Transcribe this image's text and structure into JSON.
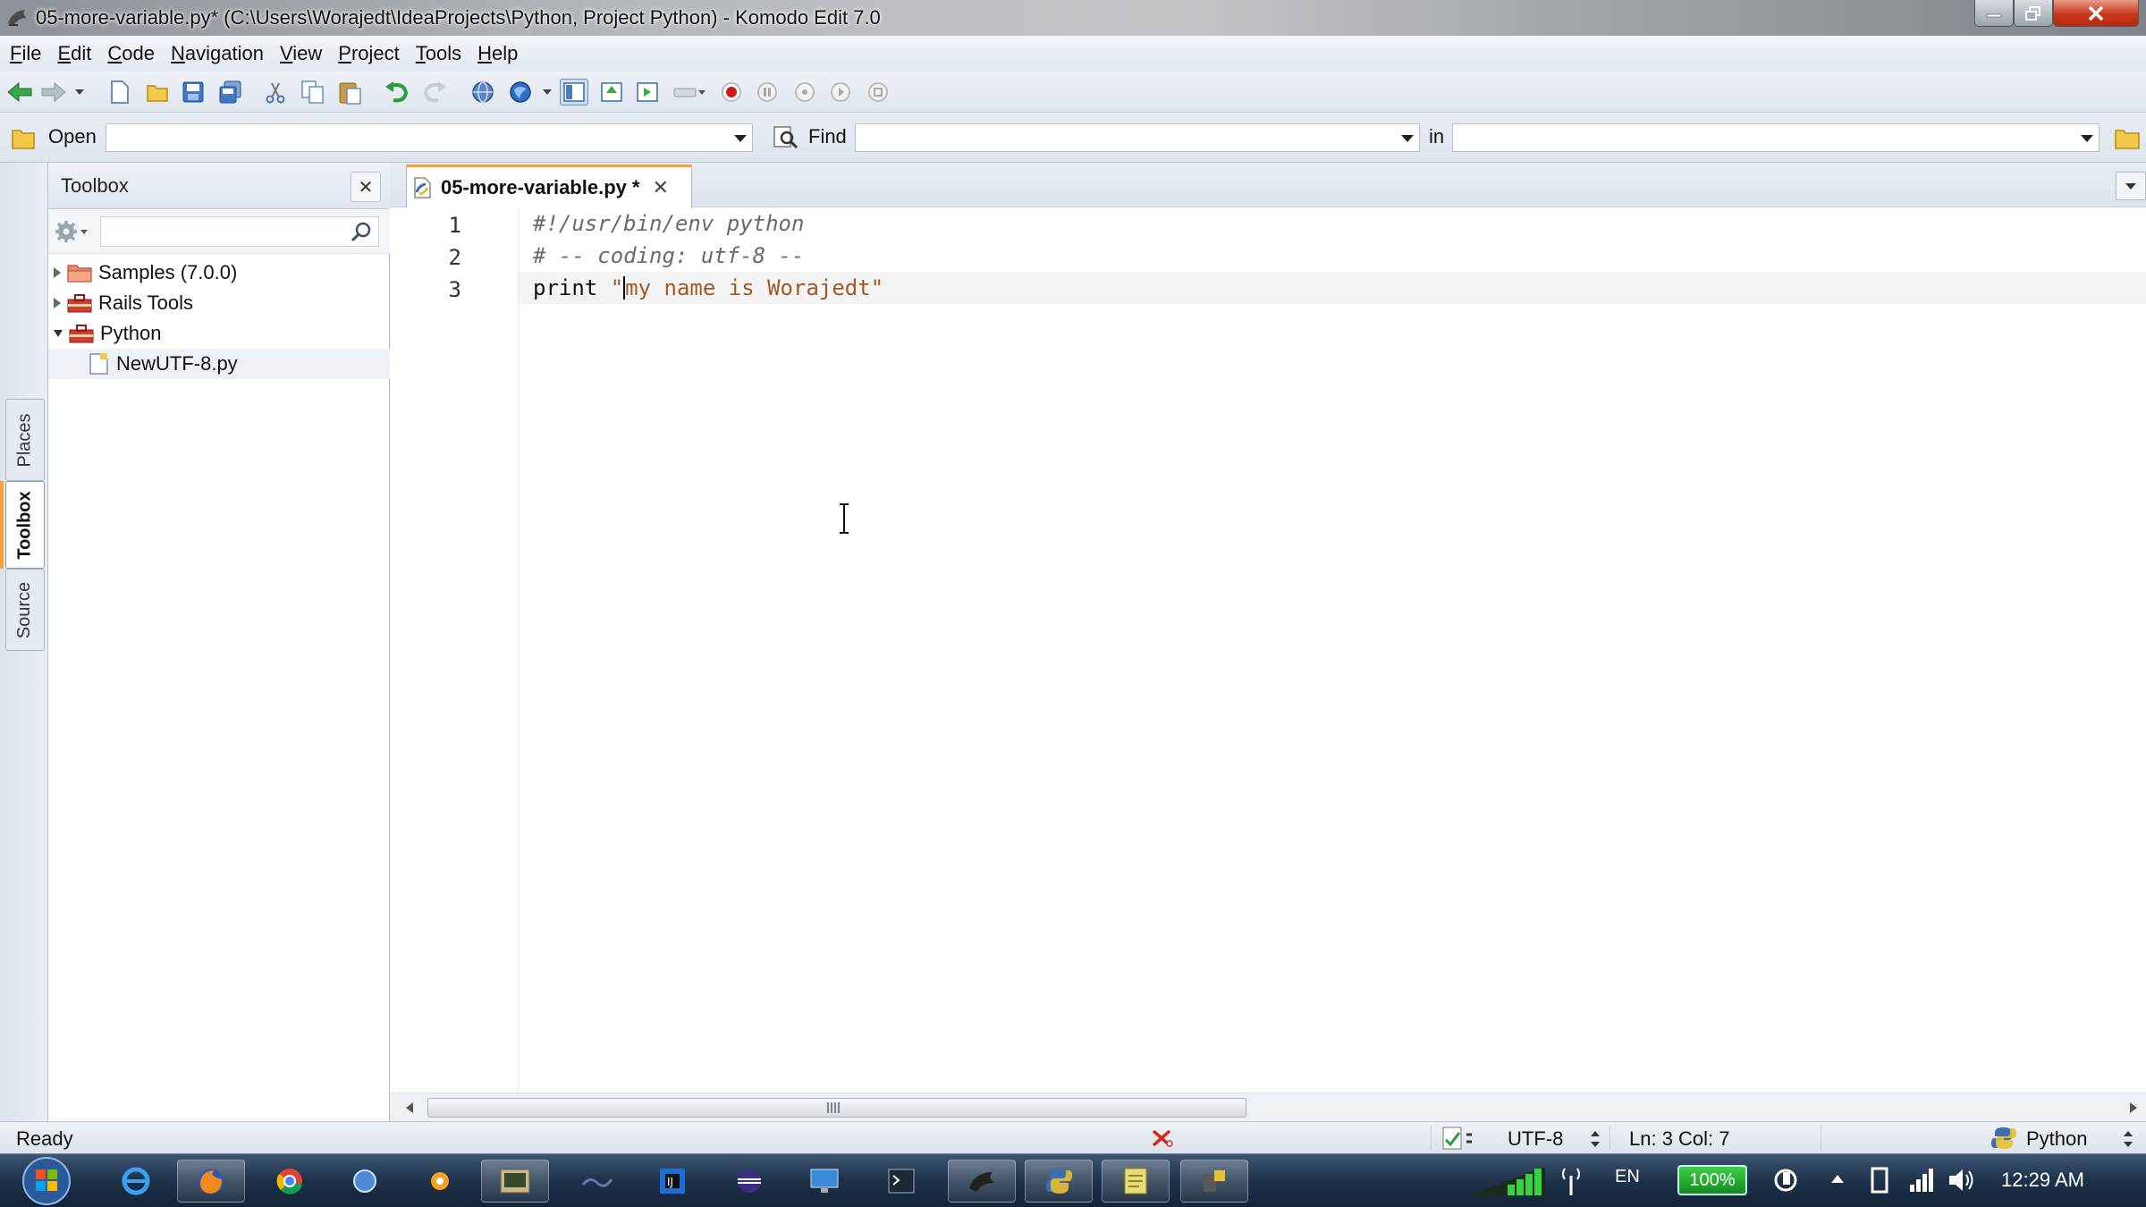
{
  "window": {
    "title": "05-more-variable.py* (C:\\Users\\Worajedt\\IdeaProjects\\Python, Project Python) - Komodo Edit 7.0"
  },
  "menu": [
    {
      "label": "File",
      "mnemonic": "F",
      "rest": "ile"
    },
    {
      "label": "Edit",
      "mnemonic": "E",
      "rest": "dit"
    },
    {
      "label": "Code",
      "mnemonic": "C",
      "rest": "ode"
    },
    {
      "label": "Navigation",
      "mnemonic": "N",
      "rest": "avigation"
    },
    {
      "label": "View",
      "mnemonic": "V",
      "rest": "iew"
    },
    {
      "label": "Project",
      "mnemonic": "P",
      "rest": "roject"
    },
    {
      "label": "Tools",
      "mnemonic": "T",
      "rest": "ools"
    },
    {
      "label": "Help",
      "mnemonic": "H",
      "rest": "elp"
    }
  ],
  "findbar": {
    "open_label": "Open",
    "open_value": "",
    "find_label": "Find",
    "find_value": "",
    "in_label": "in",
    "in_value": ""
  },
  "side_tabs": [
    "Places",
    "Toolbox",
    "Source"
  ],
  "toolbox": {
    "title": "Toolbox",
    "search_value": "",
    "tree": [
      {
        "label": "Samples (7.0.0)",
        "expanded": false
      },
      {
        "label": "Rails Tools",
        "expanded": false
      },
      {
        "label": "Python",
        "expanded": true
      },
      {
        "label": "NewUTF-8.py",
        "child": true
      }
    ]
  },
  "editor": {
    "tab_label": "05-more-variable.py *",
    "lines": [
      {
        "no": "1",
        "comment": "#!/usr/bin/env python"
      },
      {
        "no": "2",
        "comment": "# -- coding: utf-8 --"
      },
      {
        "no": "3",
        "kw": "print",
        "str_open": "\"",
        "str_rest": "my name is Worajedt\""
      }
    ]
  },
  "status": {
    "state": "Ready",
    "encoding": "UTF-8",
    "position": "Ln: 3 Col: 7",
    "language": "Python"
  },
  "tray": {
    "lang": "EN",
    "battery": "100%",
    "clock": "12:29 AM"
  },
  "colors": {
    "accent_tab": "#f2a33a",
    "string": "#a05a25",
    "comment": "#6a6a6a"
  }
}
